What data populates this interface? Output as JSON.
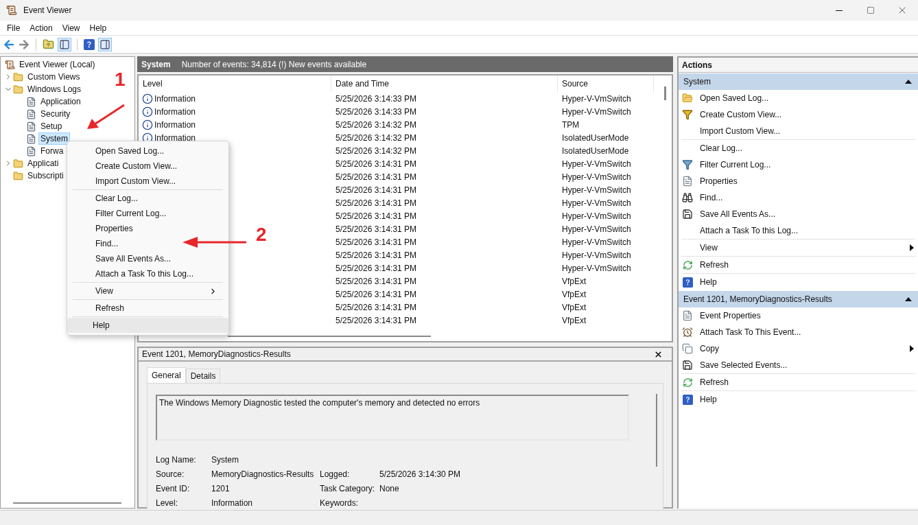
{
  "window": {
    "title": "Event Viewer"
  },
  "menu_bar": [
    "File",
    "Action",
    "View",
    "Help"
  ],
  "tree": [
    {
      "label": "Event Viewer (Local)",
      "selected": false,
      "children": [
        {
          "label": "Custom Views",
          "expanded": false,
          "selected": false
        },
        {
          "label": "Windows Logs",
          "expanded": true,
          "selected": false,
          "children": [
            {
              "label": "Application",
              "selected": false
            },
            {
              "label": "Security",
              "selected": false
            },
            {
              "label": "Setup",
              "selected": false
            },
            {
              "label": "System",
              "selected": true
            },
            {
              "label": "Forwa",
              "selected": false
            }
          ]
        },
        {
          "label": "Applicati",
          "expanded": false,
          "selected": false
        },
        {
          "label": "Subscripti",
          "selected": false
        }
      ]
    }
  ],
  "log_header": {
    "title": "System",
    "summary": "Number of events: 34,814 (!) New events available"
  },
  "table": {
    "columns": [
      "Level",
      "Date and Time",
      "Source"
    ],
    "rows": [
      {
        "level": "Information",
        "date": "5/25/2026 3:14:33 PM",
        "source": "Hyper-V-VmSwitch"
      },
      {
        "level": "Information",
        "date": "5/25/2026 3:14:33 PM",
        "source": "Hyper-V-VmSwitch"
      },
      {
        "level": "Information",
        "date": "5/25/2026 3:14:32 PM",
        "source": "TPM"
      },
      {
        "level": "Information",
        "date": "5/25/2026 3:14:32 PM",
        "source": "IsolatedUserMode"
      },
      {
        "date": "5/25/2026 3:14:32 PM",
        "source": "IsolatedUserMode"
      },
      {
        "date": "5/25/2026 3:14:31 PM",
        "source": "Hyper-V-VmSwitch"
      },
      {
        "date": "5/25/2026 3:14:31 PM",
        "source": "Hyper-V-VmSwitch"
      },
      {
        "date": "5/25/2026 3:14:31 PM",
        "source": "Hyper-V-VmSwitch"
      },
      {
        "date": "5/25/2026 3:14:31 PM",
        "source": "Hyper-V-VmSwitch"
      },
      {
        "date": "5/25/2026 3:14:31 PM",
        "source": "Hyper-V-VmSwitch"
      },
      {
        "date": "5/25/2026 3:14:31 PM",
        "source": "Hyper-V-VmSwitch"
      },
      {
        "date": "5/25/2026 3:14:31 PM",
        "source": "Hyper-V-VmSwitch"
      },
      {
        "date": "5/25/2026 3:14:31 PM",
        "source": "Hyper-V-VmSwitch"
      },
      {
        "date": "5/25/2026 3:14:31 PM",
        "source": "Hyper-V-VmSwitch"
      },
      {
        "date": "5/25/2026 3:14:31 PM",
        "source": "VfpExt"
      },
      {
        "date": "5/25/2026 3:14:31 PM",
        "source": "VfpExt"
      },
      {
        "date": "5/25/2026 3:14:31 PM",
        "source": "VfpExt"
      },
      {
        "date": "5/25/2026 3:14:31 PM",
        "source": "VfpExt"
      }
    ]
  },
  "detail": {
    "title": "Event 1201, MemoryDiagnostics-Results",
    "tabs": [
      {
        "label": "General",
        "selected": true
      },
      {
        "label": "Details",
        "selected": false
      }
    ],
    "message": "The Windows Memory Diagnostic tested the computer's memory and detected no errors",
    "fields_left": [
      {
        "label": "Log Name:",
        "value": "System"
      },
      {
        "label": "Source:",
        "value": "MemoryDiagnostics-Results"
      },
      {
        "label": "Event ID:",
        "value": "1201"
      },
      {
        "label": "Level:",
        "value": "Information"
      }
    ],
    "fields_right": [
      {
        "label": "Logged:",
        "value": "5/25/2026 3:14:30 PM"
      },
      {
        "label": "Task Category:",
        "value": "None"
      },
      {
        "label": "Keywords:"
      }
    ]
  },
  "context_menu": {
    "groups": [
      [
        {
          "label": "Open Saved Log...",
          "selected": false
        },
        {
          "label": "Create Custom View...",
          "selected": false
        },
        {
          "label": "Import Custom View...",
          "selected": false
        }
      ],
      [
        {
          "label": "Clear Log...",
          "selected": false
        },
        {
          "label": "Filter Current Log...",
          "selected": false
        },
        {
          "label": "Properties",
          "selected": false
        },
        {
          "label": "Find...",
          "selected": false
        },
        {
          "label": "Save All Events As...",
          "selected": false
        },
        {
          "label": "Attach a Task To this Log...",
          "selected": false
        }
      ],
      [
        {
          "label": "View",
          "selected": false,
          "submenu": true
        }
      ],
      [
        {
          "label": "Refresh",
          "selected": false
        }
      ],
      [
        {
          "label": "Help",
          "selected": true
        }
      ]
    ]
  },
  "actions": {
    "title": "Actions",
    "sections": [
      {
        "title": "System",
        "expanded": true,
        "groups": [
          [
            {
              "label": "Open Saved Log..."
            },
            {
              "label": "Create Custom View..."
            },
            {
              "label": "Import Custom View..."
            }
          ],
          [
            {
              "label": "Clear Log..."
            },
            {
              "label": "Filter Current Log..."
            },
            {
              "label": "Properties"
            },
            {
              "label": "Find..."
            },
            {
              "label": "Save All Events As..."
            },
            {
              "label": "Attach a Task To this Log..."
            }
          ],
          [
            {
              "label": "View",
              "submenu": true
            }
          ],
          [
            {
              "label": "Refresh"
            }
          ],
          [
            {
              "label": "Help"
            }
          ]
        ]
      },
      {
        "title": "Event 1201, MemoryDiagnostics-Results",
        "expanded": true,
        "groups": [
          [
            {
              "label": "Event Properties"
            },
            {
              "label": "Attach Task To This Event..."
            },
            {
              "label": "Copy",
              "submenu": true
            },
            {
              "label": "Save Selected Events..."
            }
          ],
          [
            {
              "label": "Refresh"
            }
          ],
          [
            {
              "label": "Help"
            }
          ]
        ]
      }
    ]
  },
  "annotations": [
    {
      "label": "1"
    },
    {
      "label": "2"
    }
  ]
}
